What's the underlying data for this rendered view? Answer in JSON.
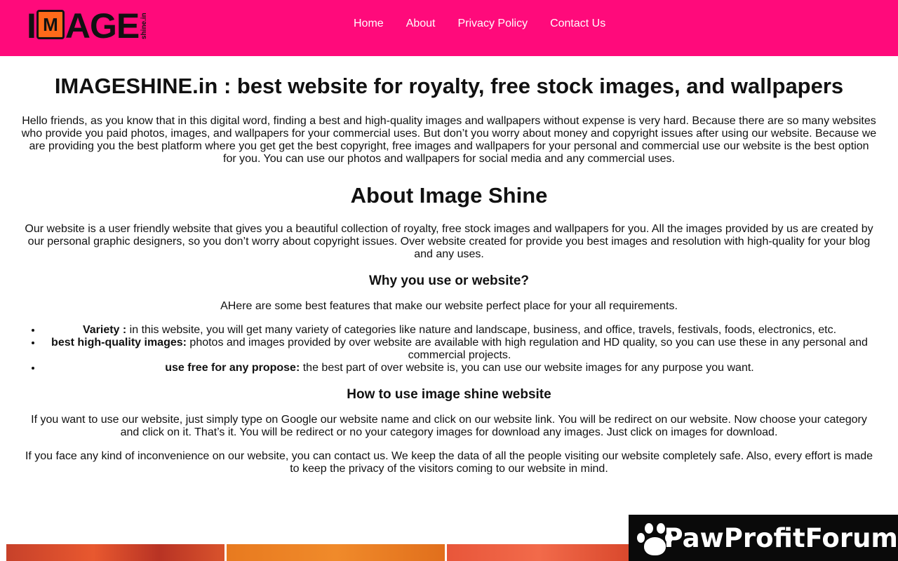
{
  "header": {
    "logo": {
      "word_left": "I",
      "word_mark": "M",
      "word_right": "AGE",
      "small": "shine.in"
    },
    "nav": [
      "Home",
      "About",
      "Privacy Policy",
      "Contact Us"
    ],
    "bg_color": "#ff0a7b"
  },
  "main": {
    "title": "IMAGESHINE.in : best website for royalty, free stock images, and wallpapers",
    "intro": "Hello friends, as you know that in this digital word, finding a best and high-quality images and wallpapers without expense is very hard. Because there are so many websites who provide you paid photos, images, and wallpapers for your commercial uses. But don’t you worry about money and copyright issues after using our website. Because we are providing you the best platform where you get get the best copyright, free images and wallpapers for your personal and commercial use our website is the best option for you. You can use our photos and wallpapers for social media and any commercial uses.",
    "about_heading": "About Image Shine",
    "about_text": "Our website is a user friendly website that gives you a beautiful collection of royalty, free stock images and wallpapers for you. All the images provided by us are created by our personal graphic designers, so you don’t worry about copyright issues. Over website created for provide you best images and resolution with high-quality for your blog and any uses.",
    "why_heading": "Why you use or website?",
    "why_intro": "AHere are some best features that make our website perfect place for your all requirements.",
    "features": [
      {
        "label": "Variety :",
        "text": " in this website, you will get many variety of categories like nature and landscape, business, and office, travels, festivals, foods, electronics, etc."
      },
      {
        "label": "best high-quality images:",
        "text": " photos and images provided by over website are available with high regulation and HD quality, so you can use these in any personal and commercial projects."
      },
      {
        "label": "use free for any propose:",
        "text": " the best part of over website is, you can use our website images for any purpose you want."
      }
    ],
    "howto_heading": "How to use image shine website",
    "howto_text": "If you want to use our website, just simply type on Google our website name and click on our website link. You will be redirect on our website. Now choose your category and click on it. That’s it. You will be redirect or no your category images for download any images. Just click on images for download.",
    "privacy_text": "If you face any kind of inconvenience on our website, you can contact us. We keep the data of all the people visiting our website completely safe. Also, every effort is made to keep the privacy of the visitors coming to our website in mind."
  },
  "badge": {
    "text": "PawProfitForum",
    "icon": "paw-icon"
  }
}
